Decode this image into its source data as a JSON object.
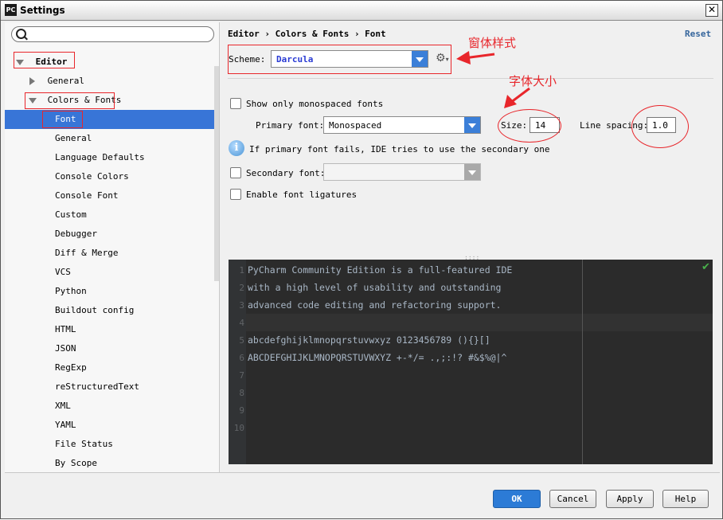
{
  "window": {
    "title": "Settings",
    "app_icon": "PC"
  },
  "search": {
    "placeholder": "",
    "value": ""
  },
  "sidebar": {
    "items": [
      {
        "label": "Editor",
        "level": 0,
        "expanded": true
      },
      {
        "label": "General",
        "level": 1,
        "expanded": false
      },
      {
        "label": "Colors & Fonts",
        "level": 1,
        "expanded": true
      },
      {
        "label": "Font",
        "level": 2,
        "selected": true
      },
      {
        "label": "General",
        "level": 2
      },
      {
        "label": "Language Defaults",
        "level": 2
      },
      {
        "label": "Console Colors",
        "level": 2
      },
      {
        "label": "Console Font",
        "level": 2
      },
      {
        "label": "Custom",
        "level": 2
      },
      {
        "label": "Debugger",
        "level": 2
      },
      {
        "label": "Diff & Merge",
        "level": 2
      },
      {
        "label": "VCS",
        "level": 2
      },
      {
        "label": "Python",
        "level": 2
      },
      {
        "label": "Buildout config",
        "level": 2
      },
      {
        "label": "HTML",
        "level": 2
      },
      {
        "label": "JSON",
        "level": 2
      },
      {
        "label": "RegExp",
        "level": 2
      },
      {
        "label": "reStructuredText",
        "level": 2
      },
      {
        "label": "XML",
        "level": 2
      },
      {
        "label": "YAML",
        "level": 2
      },
      {
        "label": "File Status",
        "level": 2
      },
      {
        "label": "By Scope",
        "level": 2
      }
    ]
  },
  "header": {
    "breadcrumb": "Editor › Colors & Fonts › Font",
    "reset": "Reset"
  },
  "scheme": {
    "label": "Scheme:",
    "value": "Darcula"
  },
  "font": {
    "monospaced_only": "Show only monospaced fonts",
    "primary_label": "Primary font:",
    "primary_value": "Monospaced",
    "size_label": "Size:",
    "size_value": "14",
    "line_spacing_label": "Line spacing:",
    "line_spacing_value": "1.0",
    "fallback_info": "If primary font fails, IDE tries to use the secondary one",
    "secondary_label": "Secondary font:",
    "secondary_value": "",
    "ligatures": "Enable font ligatures"
  },
  "preview": {
    "line_numbers": [
      "1",
      "2",
      "3",
      "4",
      "5",
      "6",
      "7",
      "8",
      "9",
      "10"
    ],
    "lines": [
      "PyCharm Community Edition is a full-featured IDE",
      "with a high level of usability and outstanding",
      "advanced code editing and refactoring support.",
      "",
      "abcdefghijklmnopqrstuvwxyz 0123456789 (){}[]",
      "ABCDEFGHIJKLMNOPQRSTUVWXYZ +-*/= .,;:!? #&$%@|^"
    ]
  },
  "buttons": {
    "ok": "OK",
    "cancel": "Cancel",
    "apply": "Apply",
    "help": "Help"
  },
  "annotations": {
    "scheme_note": "窗体样式",
    "size_note": "字体大小"
  },
  "colors": {
    "accent": "#3875d7",
    "annotation": "#e8262b",
    "editor_bg": "#2b2b2b"
  }
}
